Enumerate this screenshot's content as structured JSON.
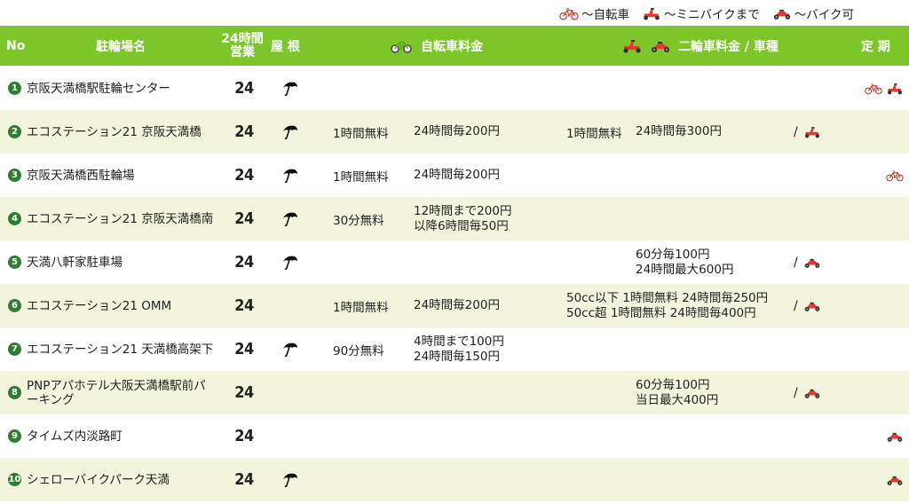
{
  "legend": {
    "bicycle_label": "～自転車",
    "minibike_label": "～ミニバイクまで",
    "bike_label": "～バイク可"
  },
  "header": {
    "no": "No",
    "name": "駐輪場名",
    "hours_line1": "24時間",
    "hours_line2": "営業",
    "roof": "屋 根",
    "bicycle_fee": "自転車料金",
    "moto_fee": "二輪車料金 / 車種",
    "teiki": "定 期"
  },
  "colors": {
    "header_bg": "#7dc62a",
    "alt_row_bg": "#f2f5dc",
    "badge": "#2e7d32",
    "moto_red": "#e53935"
  },
  "rows": [
    {
      "num": "1",
      "name": "京阪天満橋駅駐輪センター",
      "hours": "24",
      "roof": true,
      "teiki": [
        "bicycle",
        "minibike"
      ]
    },
    {
      "num": "2",
      "name": "エコステーション21 京阪天満橋",
      "hours": "24",
      "roof": true,
      "bike_free": "1時間無料",
      "bike_fee": "24時間毎200円",
      "moto_free": "1時間無料",
      "moto_fee": "24時間毎300円",
      "moto_type": "minibike",
      "slash": "/"
    },
    {
      "num": "3",
      "name": "京阪天満橋西駐輪場",
      "hours": "24",
      "roof": true,
      "bike_free": "1時間無料",
      "bike_fee": "24時間毎200円",
      "teiki": [
        "bicycle"
      ]
    },
    {
      "num": "4",
      "name": "エコステーション21 京阪天満橋南",
      "hours": "24",
      "roof": true,
      "bike_free": "30分無料",
      "bike_fee_1": "12時間まで200円",
      "bike_fee_2": "以降6時間毎50円"
    },
    {
      "num": "5",
      "name": "天満八軒家駐車場",
      "hours": "24",
      "roof": true,
      "moto_fee_1": "60分毎100円",
      "moto_fee_2": "24時間最大600円",
      "moto_type": "bike",
      "slash": "/"
    },
    {
      "num": "6",
      "name": "エコステーション21 OMM",
      "hours": "24",
      "roof": false,
      "bike_free": "1時間無料",
      "bike_fee": "24時間毎200円",
      "moto_fee_1": "50cc以下 1時間無料 24時間毎250円",
      "moto_fee_2": "50cc超 1時間無料 24時間毎400円",
      "moto_type": "bike",
      "slash": "/"
    },
    {
      "num": "7",
      "name": "エコステーション21 天満橋高架下",
      "hours": "24",
      "roof": true,
      "bike_free": "90分無料",
      "bike_fee_1": "4時間まで100円",
      "bike_fee_2": "24時間毎150円"
    },
    {
      "num": "8",
      "name_1": "PNPアパホテル大阪天満橋駅前パ",
      "name_2": "ーキング",
      "hours": "24",
      "roof": false,
      "moto_fee_1": "60分毎100円",
      "moto_fee_2": "当日最大400円",
      "moto_type": "bike",
      "slash": "/"
    },
    {
      "num": "9",
      "name": "タイムズ内淡路町",
      "hours": "24",
      "roof": false,
      "teiki": [
        "bike"
      ]
    },
    {
      "num": "10",
      "name": "シェローバイクパーク天満",
      "hours": "24",
      "roof": true,
      "teiki": [
        "bike"
      ]
    }
  ]
}
